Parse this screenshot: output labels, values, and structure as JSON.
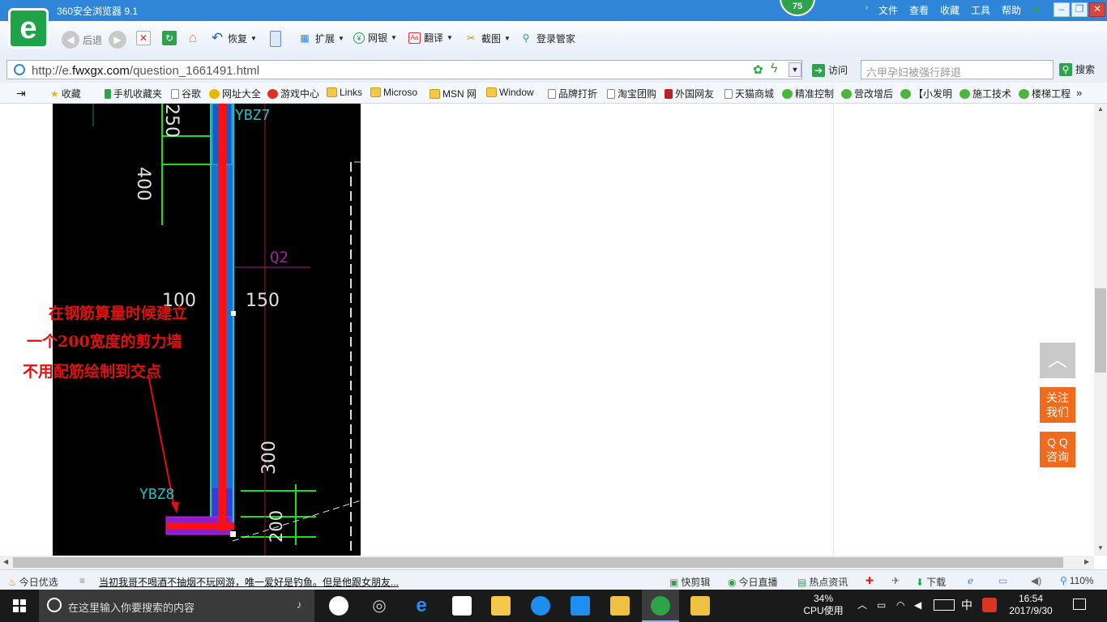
{
  "window": {
    "title": "360安全浏览器 9.1",
    "score": "75",
    "menu": [
      "文件",
      "查看",
      "收藏",
      "工具",
      "帮助"
    ]
  },
  "toolbar": {
    "back": "后退",
    "restore": "恢复",
    "extend": "扩展",
    "bank": "网银",
    "translate": "翻译",
    "screenshot": "截图",
    "login": "登录管家"
  },
  "address": {
    "prefix": "http://e.",
    "domain": "fwxgx.com",
    "path": "/question_1661491.html",
    "visit": "访问",
    "search_placeholder": "六甲孕妇被强行辞退",
    "search": "搜索"
  },
  "bookmarks": [
    "收藏",
    "手机收藏夹",
    "谷歌",
    "网址大全",
    "游戏中心",
    "Links",
    "Microso",
    "MSN 网",
    "Window",
    "品牌打折",
    "淘宝团购",
    "外国网友",
    "天猫商城",
    "精准控制",
    "营改增后",
    "【小发明",
    "施工技术",
    "楼梯工程"
  ],
  "drawing": {
    "labels": {
      "ybz7": "YBZ7",
      "ybz8": "YBZ8",
      "q2": "Q2",
      "d250": "250",
      "d400": "400",
      "d100": "100",
      "d150": "150",
      "d300": "300",
      "d200": "200"
    },
    "annotation": [
      "在钢筋算量时候建立",
      "一个200宽度的剪力墙",
      "不用配筋绘制到交点"
    ]
  },
  "side": {
    "top_icon": "chevron-up-icon",
    "follow": [
      "关注",
      "我们"
    ],
    "qq": [
      "Q Q",
      "咨询"
    ]
  },
  "status": {
    "today_pick": "今日优选",
    "news": "当初我哥不喝酒不抽烟不玩网游，唯一爱好是钓鱼。但是他跟女朋友...",
    "quick_cut": "快剪辑",
    "live": "今日直播",
    "hot": "热点资讯",
    "download": "下载",
    "zoom": "110%"
  },
  "taskbar": {
    "search_placeholder": "在这里输入你要搜索的内容",
    "cpu_percent": "34%",
    "cpu_label": "CPU使用",
    "ime": "中",
    "time": "16:54",
    "date": "2017/9/30"
  },
  "colors": {
    "titlebar": "#2f86d8",
    "brand_green": "#1fa348",
    "annotation_red": "#e01010",
    "side_orange": "#f26a1b",
    "cad_cyan": "#19c4c4",
    "cad_green": "#18e018",
    "cad_magenta": "#a020a0"
  }
}
